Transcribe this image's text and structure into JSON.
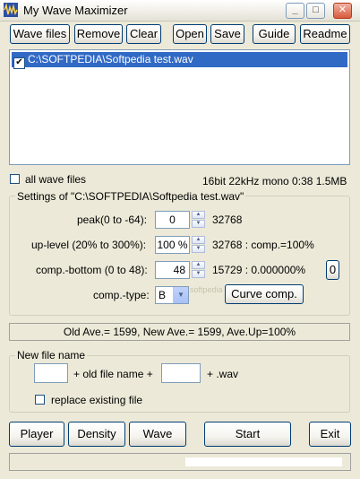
{
  "window": {
    "title": "My Wave Maximizer",
    "minimize": "_",
    "maximize": "□",
    "close": "✕"
  },
  "toolbar": {
    "wave_files": "Wave files",
    "remove": "Remove",
    "clear": "Clear",
    "open": "Open",
    "save": "Save",
    "guide": "Guide",
    "readme": "Readme"
  },
  "file_list": {
    "items": [
      {
        "name": "C:\\SOFTPEDIA\\Softpedia test.wav",
        "checked": true,
        "check_mark": "✔"
      }
    ]
  },
  "all_wave_files_label": "all wave files",
  "file_info": "16bit 22kHz mono 0:38 1.5MB",
  "settings": {
    "title": "Settings of \"C:\\SOFTPEDIA\\Softpedia test.wav\"",
    "peak_label": "peak(0 to -64):",
    "peak_value": "0",
    "peak_result": "32768",
    "uplevel_label": "up-level (20% to 300%):",
    "uplevel_value": "100 %",
    "uplevel_result": "32768 : comp.=100%",
    "compbottom_label": "comp.-bottom (0 to 48):",
    "compbottom_value": "48",
    "compbottom_result": "15729 : 0.000000%",
    "compbottom_button": "0",
    "comptype_label": "comp.-type:",
    "comptype_value": "B",
    "curve_button": "Curve comp."
  },
  "watermark": "softpedia",
  "averages": "Old Ave.= 1599, New Ave.= 1599, Ave.Up=100%",
  "new_file_name": {
    "title": "New file name",
    "prefix_value": "",
    "middle_text": "+ old file name +",
    "suffix_value": "",
    "ext_text": "+ .wav",
    "replace_label": "replace existing file"
  },
  "bottom_buttons": {
    "player": "Player",
    "density": "Density",
    "wave": "Wave",
    "start": "Start",
    "exit": "Exit"
  }
}
